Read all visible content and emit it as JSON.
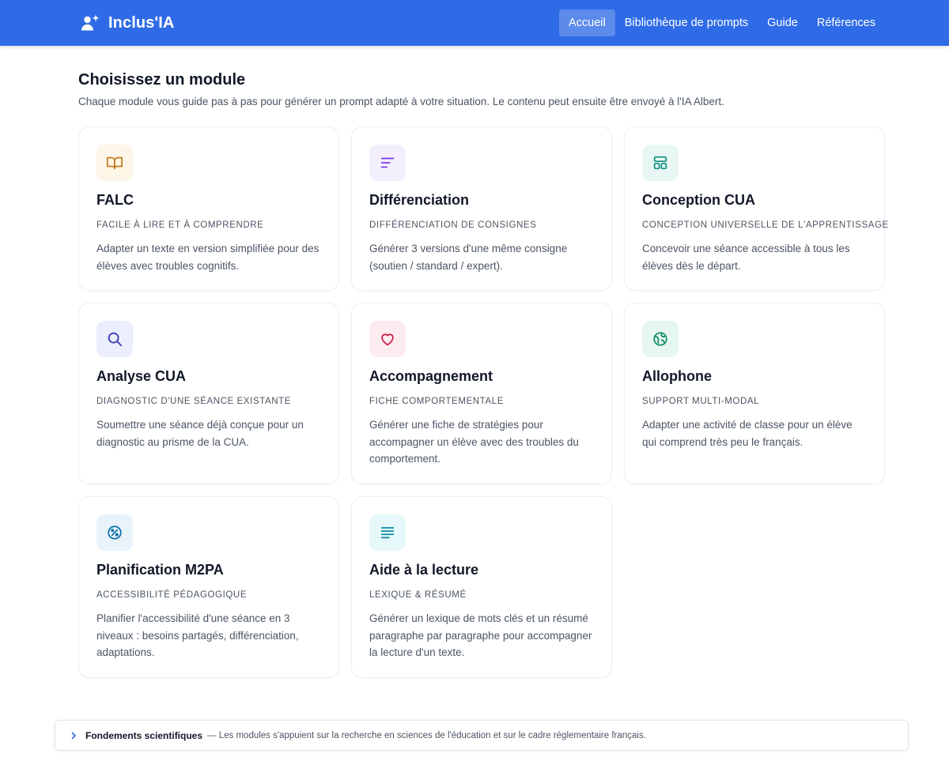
{
  "app": {
    "name": "Inclus'IA"
  },
  "nav": {
    "items": [
      {
        "label": "Accueil",
        "active": true
      },
      {
        "label": "Bibliothèque de prompts",
        "active": false
      },
      {
        "label": "Guide",
        "active": false
      },
      {
        "label": "Références",
        "active": false
      }
    ]
  },
  "header": {
    "title": "Choisissez un module",
    "subtitle": "Chaque module vous guide pas à pas pour générer un prompt adapté à votre situation. Le contenu peut ensuite être envoyé à l'IA Albert."
  },
  "modules": [
    {
      "title": "FALC",
      "subtitle": "Facile à lire et à comprendre",
      "description": "Adapter un texte en version simplifiée pour des élèves avec troubles cognitifs.",
      "icon": "book-open-icon",
      "icon_color": "#c2761a",
      "icon_bg": "#fdf5e6"
    },
    {
      "title": "Différenciation",
      "subtitle": "Différenciation de consignes",
      "description": "Générer 3 versions d'une même consigne (soutien / standard / expert).",
      "icon": "bars-left-icon",
      "icon_color": "#7c3aed",
      "icon_bg": "#f3effd"
    },
    {
      "title": "Conception CUA",
      "subtitle": "Conception universelle de l'apprentissage",
      "description": "Concevoir une séance accessible à tous les élèves dès le départ.",
      "icon": "layout-icon",
      "icon_color": "#0d8f7f",
      "icon_bg": "#e8f7f4"
    },
    {
      "title": "Analyse CUA",
      "subtitle": "Diagnostic d'une séance existante",
      "description": "Soumettre une séance déjà conçue pour un diagnostic au prisme de la CUA.",
      "icon": "search-icon",
      "icon_color": "#3b3fb5",
      "icon_bg": "#ebeefc"
    },
    {
      "title": "Accompagnement",
      "subtitle": "Fiche comportementale",
      "description": "Générer une fiche de stratégies pour accompagner un élève avec des troubles du comportement.",
      "icon": "heart-icon",
      "icon_color": "#c81e4a",
      "icon_bg": "#fdecef"
    },
    {
      "title": "Allophone",
      "subtitle": "Support multi-modal",
      "description": "Adapter une activité de classe pour un élève qui comprend très peu le français.",
      "icon": "globe-icon",
      "icon_color": "#0c8a5e",
      "icon_bg": "#e6f7ef"
    },
    {
      "title": "Planification M2PA",
      "subtitle": "Accessibilité pédagogique",
      "description": "Planifier l'accessibilité d'une séance en 3 niveaux : besoins partagés, différenciation, adaptations.",
      "icon": "compass-icon",
      "icon_color": "#0b6fa8",
      "icon_bg": "#e8f3fb"
    },
    {
      "title": "Aide à la lecture",
      "subtitle": "Lexique & résumé",
      "description": "Générer un lexique de mots clés et un résumé paragraphe par paragraphe pour accompagner la lecture d'un texte.",
      "icon": "text-lines-icon",
      "icon_color": "#0b8aa0",
      "icon_bg": "#e7f8fa"
    }
  ],
  "footer": {
    "title": "Fondements scientifiques",
    "text": "— Les modules s'appuient sur la recherche en sciences de l'éducation et sur le cadre réglementaire français."
  },
  "colors": {
    "navbar": "#2f6be6",
    "text_primary": "#111827",
    "text_secondary": "#4b5563"
  }
}
